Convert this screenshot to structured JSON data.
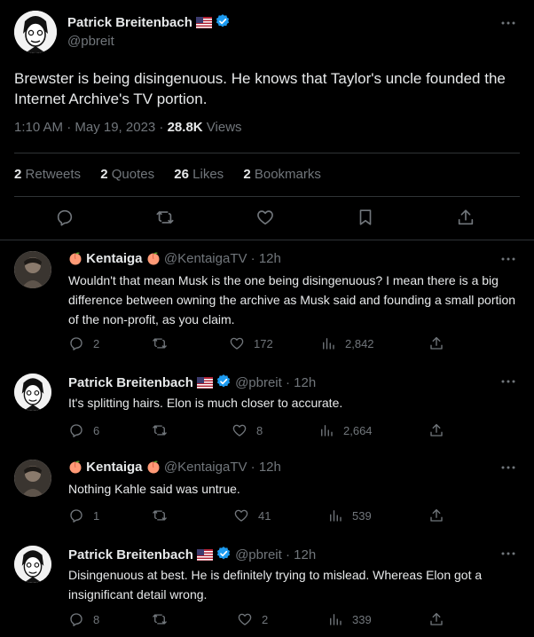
{
  "main_tweet": {
    "author_name": "Patrick Breitenbach",
    "handle": "@pbreit",
    "text": "Brewster is being disingenuous. He knows that Taylor's uncle founded the Internet Archive's TV portion.",
    "time": "1:10 AM · May 19, 2023 · ",
    "views_count": "28.8K",
    "views_label": " Views",
    "stats": {
      "retweets_count": "2",
      "retweets_label": "Retweets",
      "quotes_count": "2",
      "quotes_label": "Quotes",
      "likes_count": "26",
      "likes_label": "Likes",
      "bookmarks_count": "2",
      "bookmarks_label": "Bookmarks"
    }
  },
  "replies": [
    {
      "author_name": "Kentaiga",
      "handle": "@KentaigaTV",
      "time": "· 12h",
      "text": "Wouldn't that mean Musk is the one being disingenuous? I mean there is a big difference between owning the archive as Musk said and founding a small portion of the non-profit, as you claim.",
      "replies": "2",
      "retweets": "",
      "likes": "172",
      "views": "2,842"
    },
    {
      "author_name": "Patrick Breitenbach",
      "handle": "@pbreit",
      "time": "· 12h",
      "text": "It's splitting hairs. Elon is much closer to accurate.",
      "replies": "6",
      "retweets": "",
      "likes": "8",
      "views": "2,664"
    },
    {
      "author_name": "Kentaiga",
      "handle": "@KentaigaTV",
      "time": "· 12h",
      "text": "Nothing Kahle said was untrue.",
      "replies": "1",
      "retweets": "",
      "likes": "41",
      "views": "539"
    },
    {
      "author_name": "Patrick Breitenbach",
      "handle": "@pbreit",
      "time": "· 12h",
      "text": "Disingenuous at best. He is definitely trying to mislead.  Whereas Elon got a insignificant detail wrong.",
      "replies": "8",
      "retweets": "",
      "likes": "2",
      "views": "339"
    }
  ],
  "icons": [
    "more-icon",
    "reply-icon",
    "retweet-icon",
    "like-icon",
    "bookmark-icon",
    "share-icon",
    "views-icon",
    "verified-icon",
    "us-flag-icon",
    "peach-icon"
  ],
  "colors": {
    "background": "#000000",
    "text": "#e7e9ea",
    "muted": "#71767b",
    "border": "#2f3336",
    "verified": "#1d9bf0"
  }
}
